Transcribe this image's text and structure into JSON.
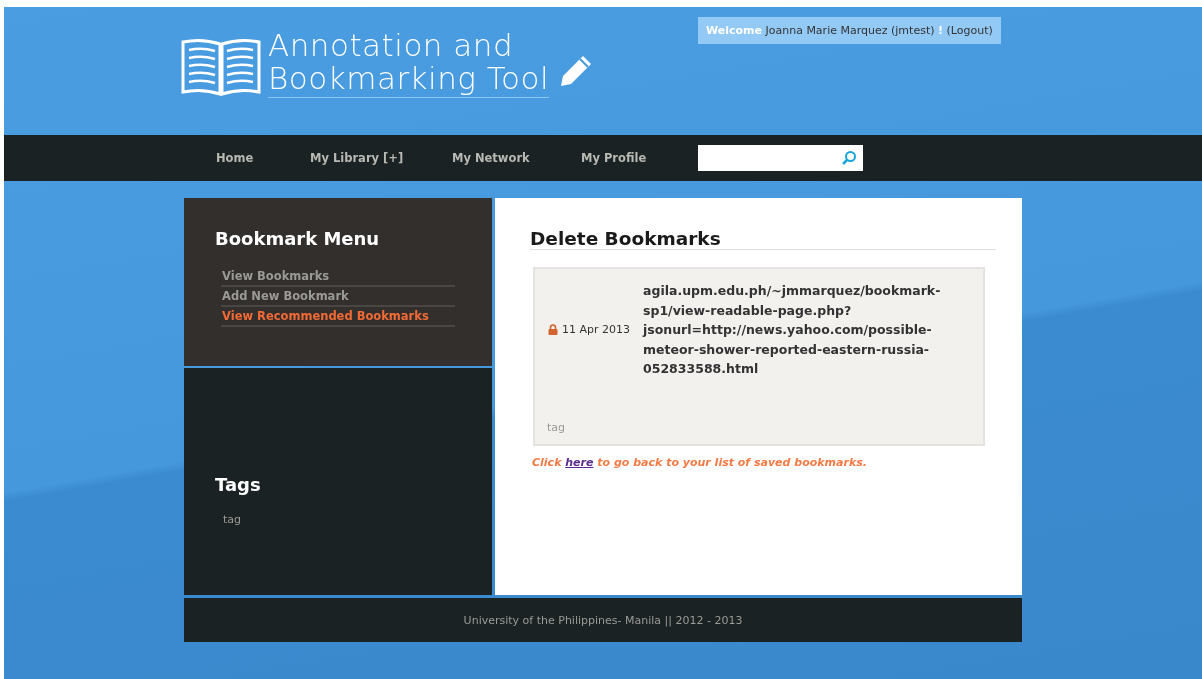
{
  "header": {
    "title_lines": [
      "Annotation and",
      "Bookmarking Tool"
    ],
    "welcome": {
      "greeting": "Welcome",
      "user": "Joanna Marie Marquez (jmtest)",
      "exclaim": "!",
      "logout": "(Logout)"
    }
  },
  "nav": {
    "items": [
      {
        "label": "Home"
      },
      {
        "label": "My Library [+]"
      },
      {
        "label": "My Network"
      },
      {
        "label": "My Profile"
      }
    ]
  },
  "sidebar": {
    "menu_title": "Bookmark Menu",
    "menu_items": [
      {
        "label": "View Bookmarks",
        "selected": false
      },
      {
        "label": "Add New Bookmark",
        "selected": false
      },
      {
        "label": "View Recommended Bookmarks",
        "selected": true
      }
    ],
    "tags_title": "Tags",
    "tags": [
      "tag"
    ]
  },
  "main": {
    "title": "Delete Bookmarks",
    "bookmarks": [
      {
        "locked": true,
        "date": "11 Apr 2013",
        "url": "agila.upm.edu.ph/~jmmarquez/bookmark-sp1/view-readable-page.php?jsonurl=http://news.yahoo.com/possible-meteor-shower-reported-eastern-russia-052833588.html",
        "tags": [
          "tag"
        ]
      }
    ],
    "back_note": {
      "before": "Click ",
      "link": "here",
      "after": " to go back to your list of saved bookmarks."
    }
  },
  "footer": {
    "text": "University of the Philippines- Manila || 2012 - 2013"
  }
}
